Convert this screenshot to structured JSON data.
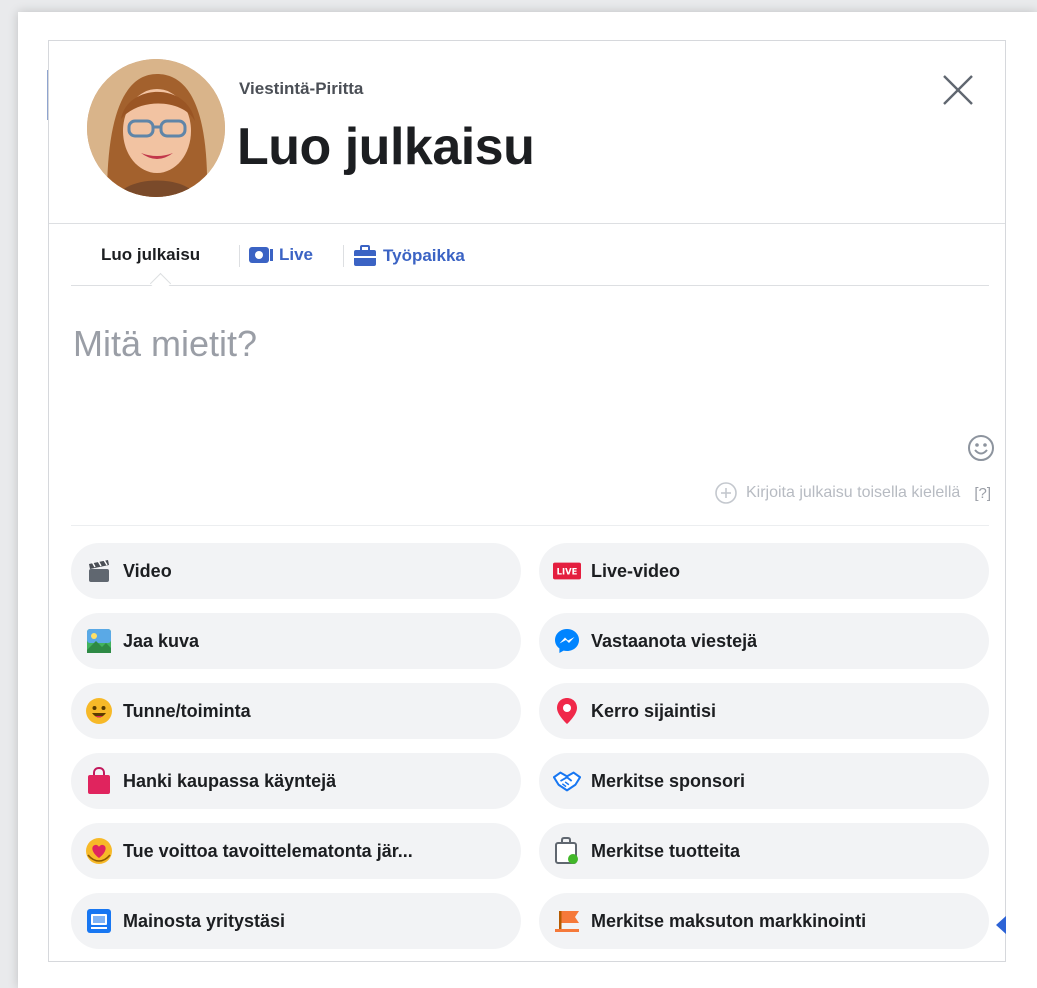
{
  "header": {
    "page_name": "Viestintä-Piritta",
    "title": "Luo julkaisu"
  },
  "tabs": [
    {
      "label": "Luo julkaisu"
    },
    {
      "label": "Live"
    },
    {
      "label": "Työpaikka"
    }
  ],
  "composer": {
    "placeholder": "Mitä mietit?"
  },
  "translate": {
    "label": "Kirjoita julkaisu toisella kielellä",
    "help": "[?]"
  },
  "options": {
    "video": "Video",
    "live_video": "Live-video",
    "share_photo": "Jaa kuva",
    "get_messages": "Vastaanota viestejä",
    "feeling": "Tunne/toiminta",
    "location": "Kerro sijaintisi",
    "store_visits": "Hanki kaupassa käyntejä",
    "tag_sponsor": "Merkitse sponsori",
    "support_nonprofit": "Tue voittoa tavoittelematonta jär...",
    "tag_products": "Merkitse tuotteita",
    "promote_business": "Mainosta yritystäsi",
    "free_marketing": "Merkitse maksuton markkinointi"
  },
  "icons": {
    "live_badge": "LIVE"
  },
  "colors": {
    "accent": "#3b63c4",
    "live_red": "#e0245e",
    "messenger_blue": "#0084ff"
  }
}
